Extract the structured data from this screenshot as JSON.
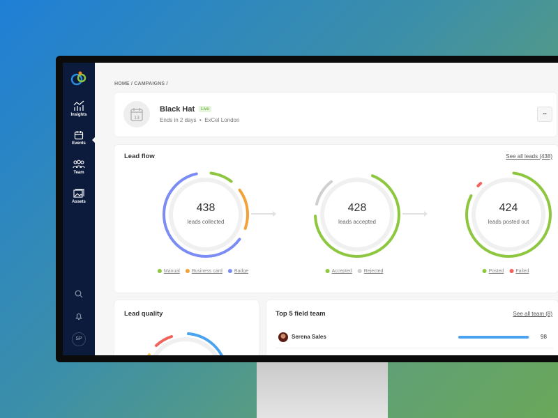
{
  "breadcrumb": "HOME / CAMPAIGNS /",
  "sidebar": {
    "items": [
      {
        "label": "Insights"
      },
      {
        "label": "Events"
      },
      {
        "label": "Team"
      },
      {
        "label": "Assets"
      }
    ],
    "avatar": "SP"
  },
  "event": {
    "title": "Black Hat",
    "badge": "Live",
    "ends": "Ends in 2 days",
    "location": "ExCel London",
    "calendar_day": "13",
    "more": "•••"
  },
  "lead_flow": {
    "title": "Lead flow",
    "link": "See all leads (438)",
    "rings": [
      {
        "value": "438",
        "label": "leads collected",
        "segments": [
          {
            "name": "Manual",
            "color": "#8dc63f",
            "fraction": 0.1
          },
          {
            "name": "Business card",
            "color": "#f2a23a",
            "fraction": 0.17
          },
          {
            "name": "Badge",
            "color": "#7b8cf5",
            "fraction": 0.63
          }
        ]
      },
      {
        "value": "428",
        "label": "leads accepted",
        "segments": [
          {
            "name": "Accepted",
            "color": "#8dc63f",
            "fraction": 0.7
          },
          {
            "name": "Rejected",
            "color": "#cfcfcf",
            "fraction": 0.12
          }
        ]
      },
      {
        "value": "424",
        "label": "leads posted out",
        "segments": [
          {
            "name": "Posted",
            "color": "#8dc63f",
            "fraction": 0.82
          },
          {
            "name": "Failed",
            "color": "#f0625a",
            "fraction": 0.03
          }
        ]
      }
    ]
  },
  "lead_quality": {
    "title": "Lead quality"
  },
  "team": {
    "title": "Top 5 field team",
    "link": "See all team (8)",
    "members": [
      {
        "name": "Serena Sales",
        "score": "98",
        "fraction": 0.98
      }
    ]
  },
  "colors": {
    "sidebar": "#0c1a3c",
    "accent": "#4aa3f0"
  }
}
